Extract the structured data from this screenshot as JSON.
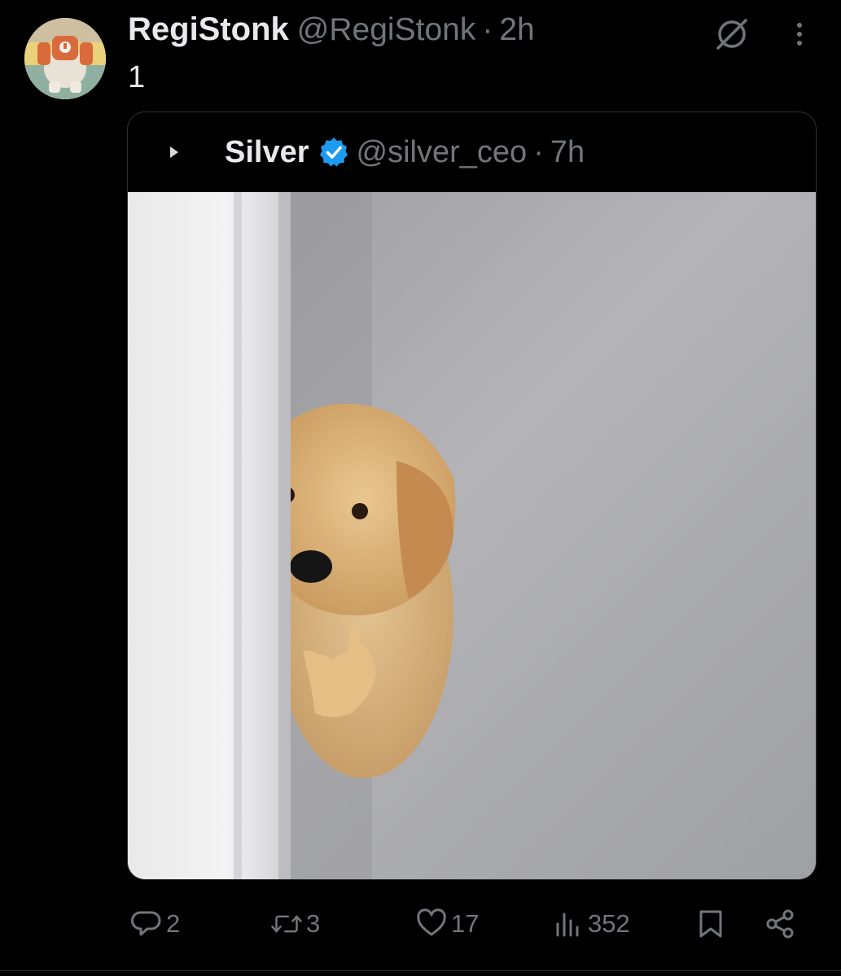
{
  "tweet": {
    "display_name": "RegiStonk",
    "handle": "@RegiStonk",
    "separator": "·",
    "time": "2h",
    "text": "1"
  },
  "quote": {
    "display_name": "Silver",
    "handle": "@silver_ceo",
    "separator": "·",
    "time": "7h",
    "verified": true,
    "image_description_icon": "puppy-photo"
  },
  "actions": {
    "replies": "2",
    "retweets": "3",
    "likes": "17",
    "views": "352"
  },
  "colors": {
    "background": "#000000",
    "text_primary": "#e7e9ea",
    "text_secondary": "#71767b",
    "verified_blue": "#1d9bf0",
    "border": "#2f3336"
  },
  "icons": {
    "header_right": [
      "grok-icon",
      "more-icon"
    ],
    "actions": [
      "reply-icon",
      "retweet-icon",
      "like-icon",
      "views-icon",
      "bookmark-icon",
      "share-icon"
    ]
  }
}
